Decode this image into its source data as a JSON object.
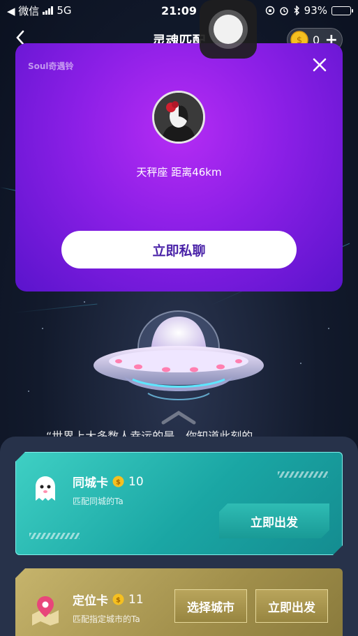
{
  "status_bar": {
    "carrier": "◀ 微信",
    "network": "5G",
    "time": "21:09",
    "battery_percent": "93%",
    "battery_level": 0.93
  },
  "nav": {
    "back_icon": "chevron-left-icon",
    "title": "灵魂匹配",
    "coin_count": "0",
    "plus_label": "+"
  },
  "match_card": {
    "brand": "Soul奇遇铃",
    "close_icon": "close-icon",
    "info": "天秤座  距离46km",
    "chat_button": "立即私聊"
  },
  "tagline": "“世界上大多数人幸运的是，你知道此刻的",
  "cards": [
    {
      "title": "同城卡",
      "price": "10",
      "description": "匹配同城的Ta",
      "go_button": "立即出发",
      "accent": "#1aa6a4"
    },
    {
      "title": "定位卡",
      "price": "11",
      "description": "匹配指定城市的Ta",
      "select_button": "选择城市",
      "go_button": "立即出发",
      "accent": "#a08e4a"
    }
  ],
  "colors": {
    "card_purple": "#8b1fe6",
    "chat_button_text": "#4a23a8",
    "coin_gold": "#f5c020"
  }
}
